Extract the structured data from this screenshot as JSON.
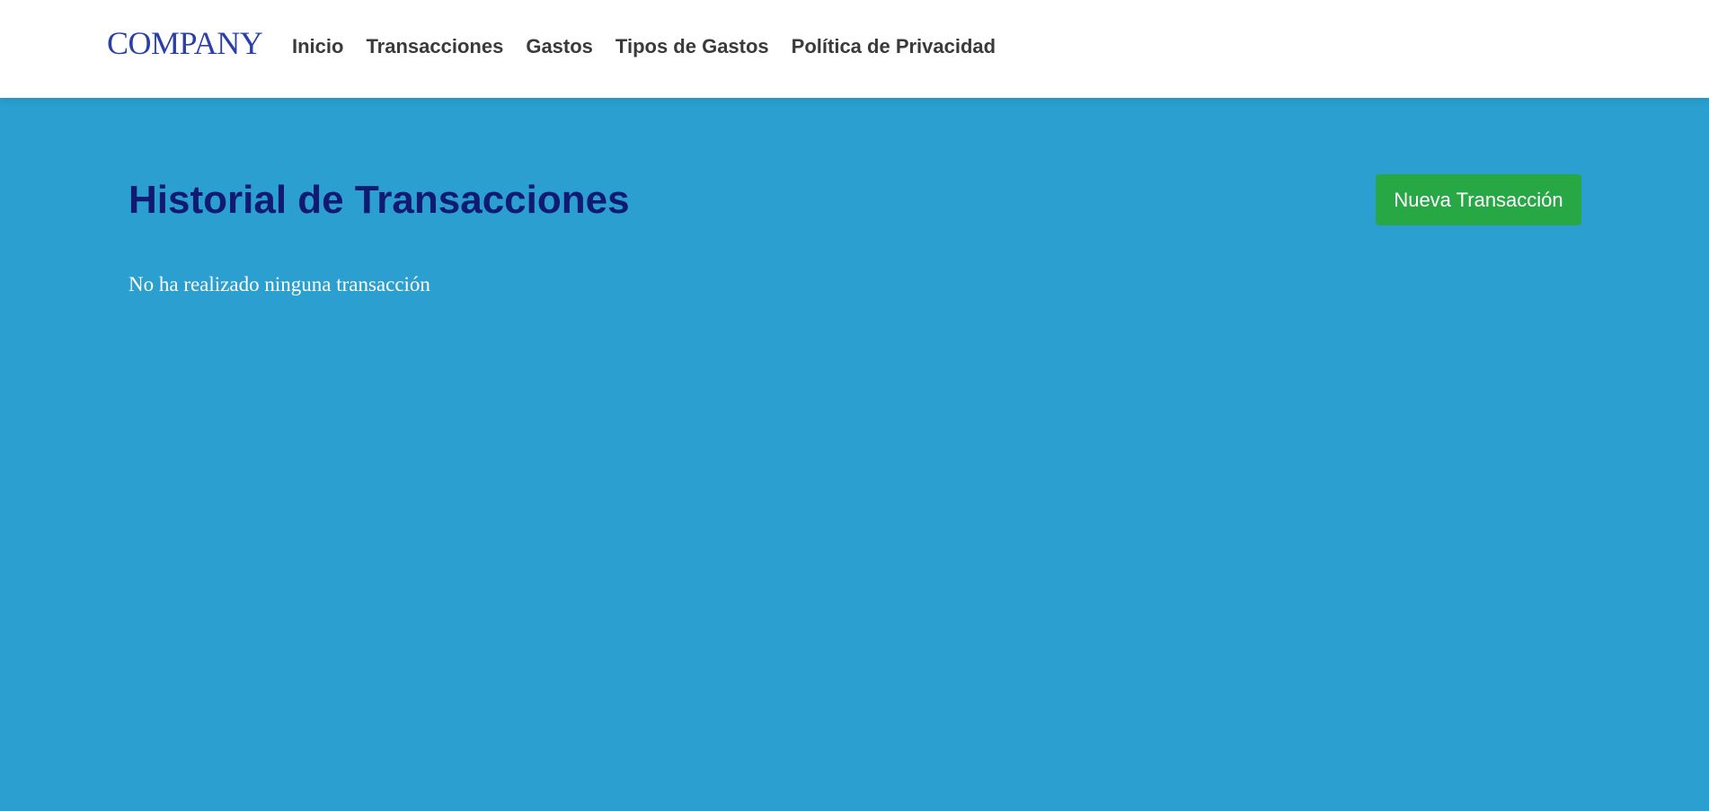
{
  "navbar": {
    "brand": "COMPANY",
    "links": [
      {
        "label": "Inicio"
      },
      {
        "label": "Transacciones"
      },
      {
        "label": "Gastos"
      },
      {
        "label": "Tipos de Gastos"
      },
      {
        "label": "Política de Privacidad"
      }
    ]
  },
  "main": {
    "title": "Historial de Transacciones",
    "new_button_label": "Nueva Transacción",
    "empty_message": "No ha realizado ninguna transacción"
  },
  "colors": {
    "brand": "#2a3fa8",
    "background": "#2a9fd0",
    "title": "#101a70",
    "button": "#28a745",
    "navbar_bg": "#ffffff"
  }
}
